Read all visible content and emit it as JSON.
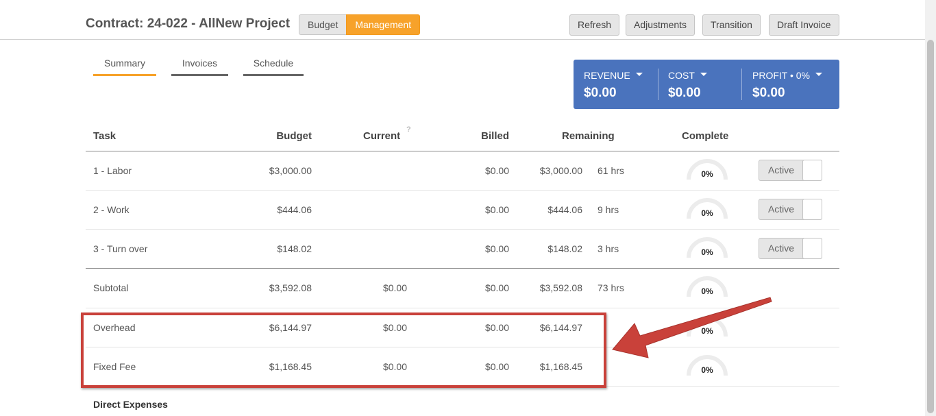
{
  "header": {
    "title": "Contract: 24-022 - AllNew Project",
    "view_toggle": {
      "budget": "Budget",
      "management": "Management"
    },
    "buttons": {
      "refresh": "Refresh",
      "adjustments": "Adjustments",
      "transition": "Transition",
      "draft_invoice": "Draft Invoice"
    }
  },
  "tabs": [
    "Summary",
    "Invoices",
    "Schedule"
  ],
  "active_tab": "Summary",
  "summary": {
    "revenue": {
      "label": "REVENUE",
      "value": "$0.00"
    },
    "cost": {
      "label": "COST",
      "value": "$0.00"
    },
    "profit": {
      "label": "PROFIT",
      "pct": "0%",
      "value": "$0.00"
    }
  },
  "table": {
    "headers": {
      "task": "Task",
      "budget": "Budget",
      "current": "Current",
      "billed": "Billed",
      "remaining": "Remaining",
      "complete": "Complete"
    },
    "help_icon": "?",
    "rows": [
      {
        "task": "1 - Labor",
        "budget": "$3,000.00",
        "current": "",
        "billed": "$0.00",
        "remaining": "$3,000.00",
        "hours": "61 hrs",
        "complete": "0%",
        "status": "Active"
      },
      {
        "task": "2 - Work",
        "budget": "$444.06",
        "current": "",
        "billed": "$0.00",
        "remaining": "$444.06",
        "hours": "9 hrs",
        "complete": "0%",
        "status": "Active"
      },
      {
        "task": "3 - Turn over",
        "budget": "$148.02",
        "current": "",
        "billed": "$0.00",
        "remaining": "$148.02",
        "hours": "3 hrs",
        "complete": "0%",
        "status": "Active"
      }
    ],
    "subtotal": {
      "task": "Subtotal",
      "budget": "$3,592.08",
      "current": "$0.00",
      "billed": "$0.00",
      "remaining": "$3,592.08",
      "hours": "73 hrs",
      "complete": "0%"
    },
    "overhead": {
      "task": "Overhead",
      "budget": "$6,144.97",
      "current": "$0.00",
      "billed": "$0.00",
      "remaining": "$6,144.97",
      "complete": "0%"
    },
    "fixed_fee": {
      "task": "Fixed Fee",
      "budget": "$1,168.45",
      "current": "$0.00",
      "billed": "$0.00",
      "remaining": "$1,168.45",
      "complete": "0%"
    }
  },
  "direct_expenses": "Direct Expenses",
  "colors": {
    "accent": "#f7a22a",
    "summary_bg": "#4a73bd",
    "annotation": "#c9413a"
  },
  "icons": [
    "caret-down-icon",
    "help-icon",
    "gauge-icon",
    "annotation-arrow-icon"
  ]
}
